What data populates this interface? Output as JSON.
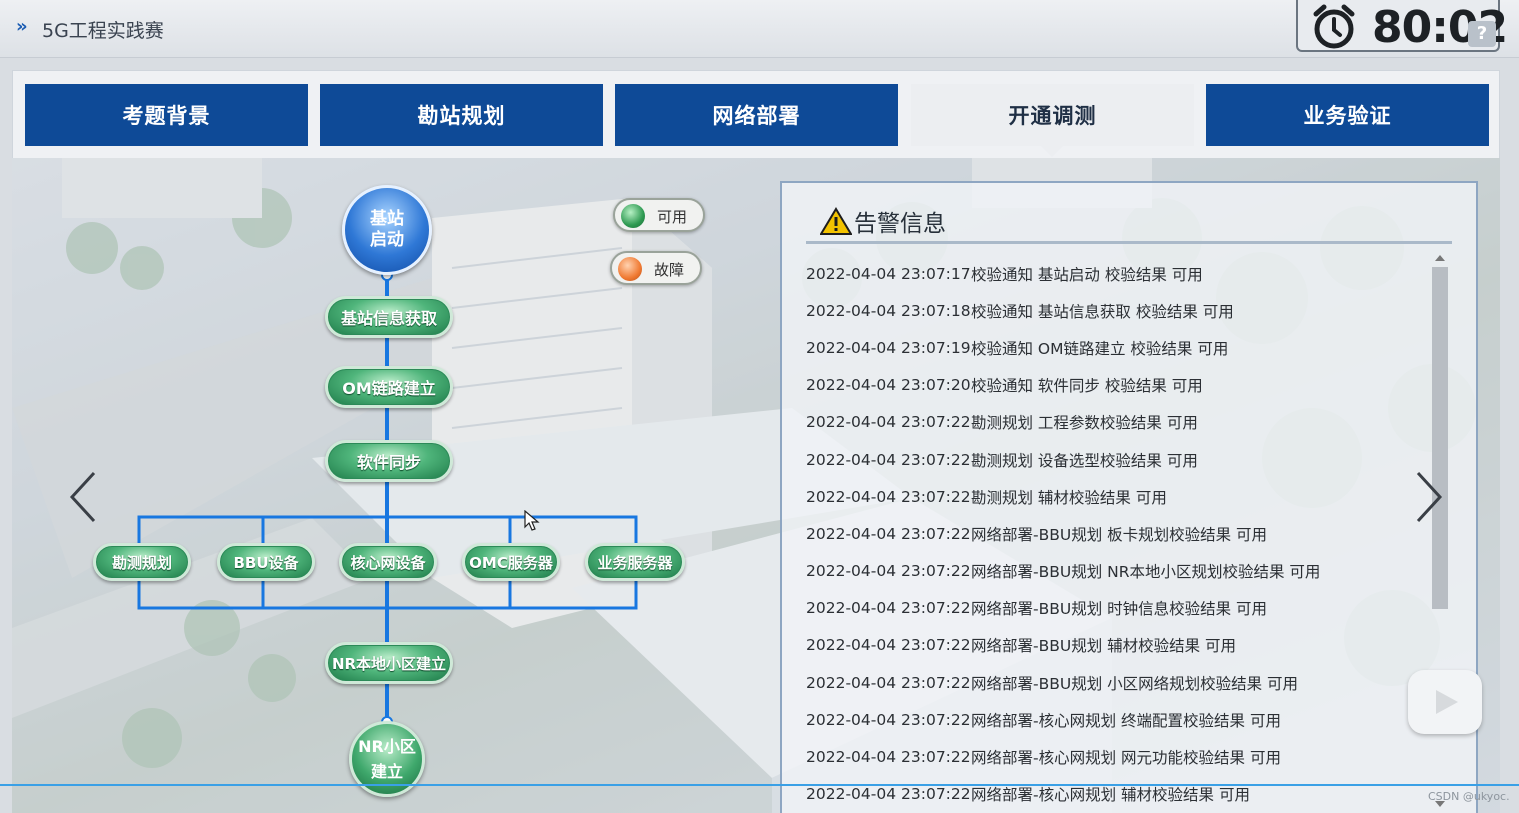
{
  "header": {
    "title": "5G工程实践赛",
    "timer": "80:02",
    "help_label": "?"
  },
  "tabs": [
    {
      "label": "考题背景"
    },
    {
      "label": "勘站规划"
    },
    {
      "label": "网络部署"
    },
    {
      "label": "开通调测"
    },
    {
      "label": "业务验证"
    }
  ],
  "active_tab": "开通调测",
  "legend": {
    "available": "可用",
    "fault": "故障",
    "available_color": "#2f9a52",
    "fault_color": "#f07a32"
  },
  "flow": {
    "start": "基站启动",
    "start_line1": "基站",
    "start_line2": "启动",
    "step1": "基站信息获取",
    "step2": "OM链路建立",
    "step3": "软件同步",
    "branches": [
      "勘测规划",
      "BBU设备",
      "核心网设备",
      "OMC服务器",
      "业务服务器"
    ],
    "step4": "NR本地小区建立",
    "end_line1": "NR小区",
    "end_line2": "建立"
  },
  "alerts": {
    "title": "告警信息",
    "rows": [
      {
        "time": "2022-04-04 23:07:17",
        "text": "校验通知 基站启动 校验结果 可用"
      },
      {
        "time": "2022-04-04 23:07:18",
        "text": "校验通知 基站信息获取 校验结果 可用"
      },
      {
        "time": "2022-04-04 23:07:19",
        "text": "校验通知 OM链路建立 校验结果 可用"
      },
      {
        "time": "2022-04-04 23:07:20",
        "text": "校验通知 软件同步 校验结果 可用"
      },
      {
        "time": "2022-04-04 23:07:22",
        "text": "勘测规划 工程参数校验结果 可用"
      },
      {
        "time": "2022-04-04 23:07:22",
        "text": "勘测规划 设备选型校验结果 可用"
      },
      {
        "time": "2022-04-04 23:07:22",
        "text": "勘测规划 辅材校验结果 可用"
      },
      {
        "time": "2022-04-04 23:07:22",
        "text": "网络部署-BBU规划 板卡规划校验结果 可用"
      },
      {
        "time": "2022-04-04 23:07:22",
        "text": "网络部署-BBU规划 NR本地小区规划校验结果 可用"
      },
      {
        "time": "2022-04-04 23:07:22",
        "text": "网络部署-BBU规划 时钟信息校验结果 可用"
      },
      {
        "time": "2022-04-04 23:07:22",
        "text": "网络部署-BBU规划 辅材校验结果 可用"
      },
      {
        "time": "2022-04-04 23:07:22",
        "text": "网络部署-BBU规划 小区网络规划校验结果 可用"
      },
      {
        "time": "2022-04-04 23:07:22",
        "text": "网络部署-核心网规划 终端配置校验结果 可用"
      },
      {
        "time": "2022-04-04 23:07:22",
        "text": "网络部署-核心网规划 网元功能校验结果 可用"
      },
      {
        "time": "2022-04-04 23:07:22",
        "text": "网络部署-核心网规划 辅材校验结果 可用"
      }
    ]
  },
  "watermark": "CSDN @ukyoc.",
  "icons": [
    "chevron-double-right-icon",
    "alarm-clock-icon",
    "help-icon",
    "warning-icon",
    "chevron-left-icon",
    "chevron-right-icon",
    "play-icon",
    "cursor-icon"
  ]
}
